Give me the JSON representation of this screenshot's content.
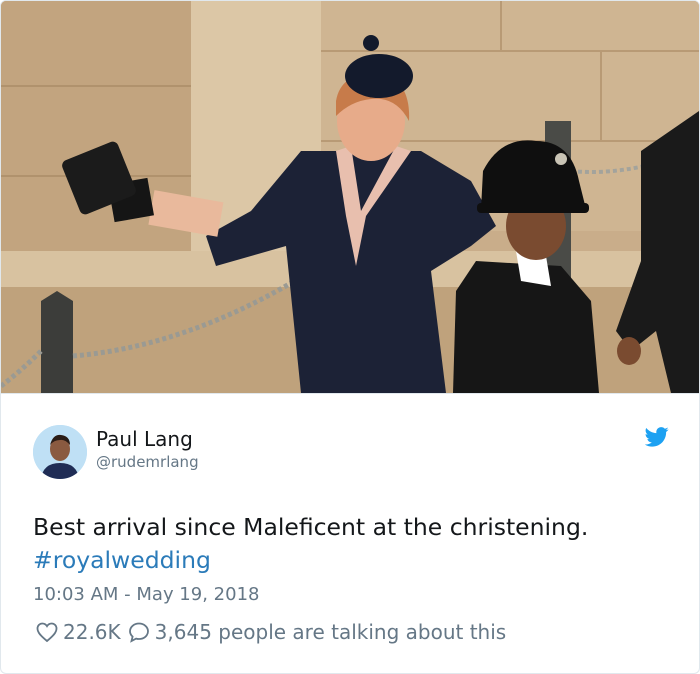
{
  "tweet": {
    "author_name": "Paul Lang",
    "author_handle": "@rudemrlang",
    "text": "Best arrival since Maleficent at the christening.",
    "hashtag": "#royalwedding",
    "timestamp": "10:03 AM - May 19, 2018",
    "like_count": "22.6K",
    "talking_text": "3,645 people are talking about this"
  },
  "icons": {
    "brand": "twitter-bird-icon",
    "like": "heart-icon",
    "reply": "speech-bubble-icon"
  },
  "colors": {
    "brand_blue": "#1da1f2",
    "link_blue": "#2b7bb9",
    "secondary_text": "#657786",
    "primary_text": "#14171a"
  }
}
